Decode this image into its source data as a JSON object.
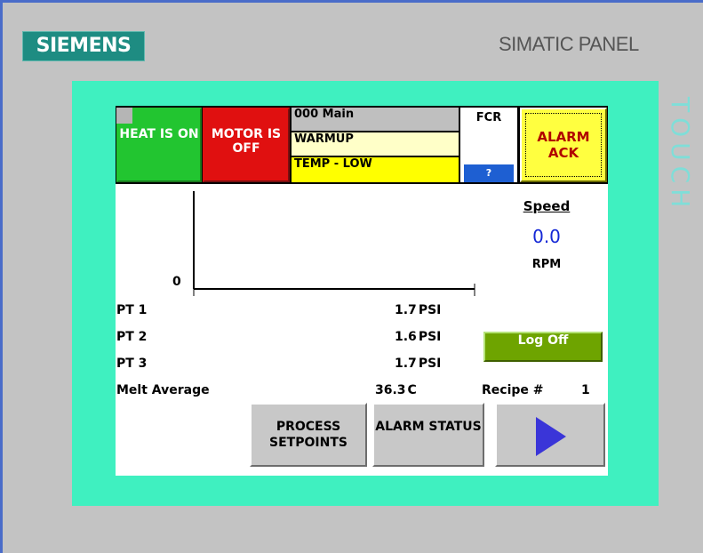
{
  "device": {
    "brand": "SIEMENS",
    "model": "SIMATIC PANEL",
    "touch_label": "TOUCH"
  },
  "header": {
    "heat_label": "HEAT IS ON",
    "motor_label": "MOTOR IS OFF",
    "status_lines": [
      "000 Main",
      "WARMUP",
      "TEMP - LOW"
    ],
    "fcr_label": "FCR",
    "fcr_help": "?",
    "alarm_ack_label": "ALARM ACK"
  },
  "chart": {
    "y_min_label": "0"
  },
  "speed": {
    "label": "Speed",
    "value": "0.0",
    "unit": "RPM"
  },
  "pressures": [
    {
      "name": "PT 1",
      "value": "1.7",
      "unit": "PSI"
    },
    {
      "name": "PT 2",
      "value": "1.6",
      "unit": "PSI"
    },
    {
      "name": "PT 3",
      "value": "1.7",
      "unit": "PSI"
    }
  ],
  "melt": {
    "name": "Melt Average",
    "value": "36.3",
    "unit": "C"
  },
  "recipe": {
    "label": "Recipe #",
    "value": "1"
  },
  "buttons": {
    "log_off": "Log Off",
    "process_setpoints": "PROCESS SETPOINTS",
    "alarm_status": "ALARM STATUS"
  },
  "colors": {
    "heat_on": "#22c530",
    "motor_off": "#e01010",
    "alarm_ack": "#ffff40",
    "bezel": "#3ff0c0",
    "log_off": "#6ea400",
    "speed_value": "#1528d6"
  },
  "icons": {
    "next": "play-arrow-icon"
  }
}
